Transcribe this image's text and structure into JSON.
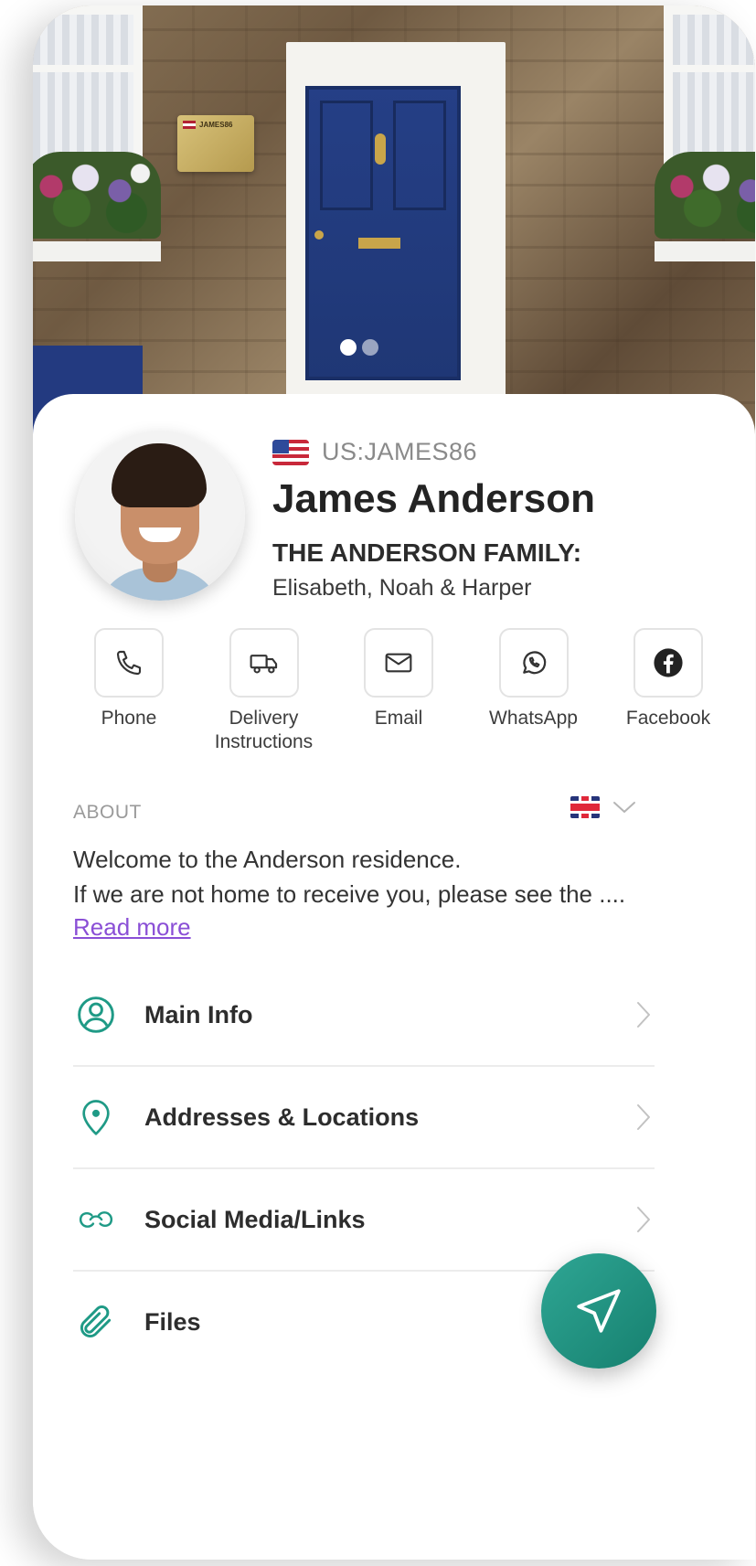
{
  "hero": {
    "plaque_text": "JAMES86",
    "carousel": {
      "count": 2,
      "active": 1
    }
  },
  "profile": {
    "country_flag": "us-flag-icon",
    "user_id": "US:JAMES86",
    "name": "James Anderson",
    "family_title": "THE ANDERSON FAMILY:",
    "family_members": "Elisabeth, Noah & Harper"
  },
  "actions": [
    {
      "label": "Phone",
      "icon": "phone-icon"
    },
    {
      "label": "Delivery\nInstructions",
      "icon": "delivery-truck-icon"
    },
    {
      "label": "Email",
      "icon": "email-icon"
    },
    {
      "label": "WhatsApp",
      "icon": "whatsapp-icon"
    },
    {
      "label": "Facebook",
      "icon": "facebook-icon"
    }
  ],
  "about": {
    "label": "ABOUT",
    "language_flag": "uk-flag-icon",
    "line1": "Welcome to the Anderson residence.",
    "line2": "If we are not home to receive you, please see the ....",
    "read_more": "Read more"
  },
  "menu": [
    {
      "label": "Main Info",
      "icon": "user-circle-icon"
    },
    {
      "label": "Addresses & Locations",
      "icon": "location-pin-icon"
    },
    {
      "label": "Social Media/Links",
      "icon": "link-icon"
    },
    {
      "label": "Files",
      "icon": "paperclip-icon"
    }
  ],
  "colors": {
    "accent": "#1f9a86",
    "link": "#8a4fd6",
    "door": "#253f86"
  }
}
